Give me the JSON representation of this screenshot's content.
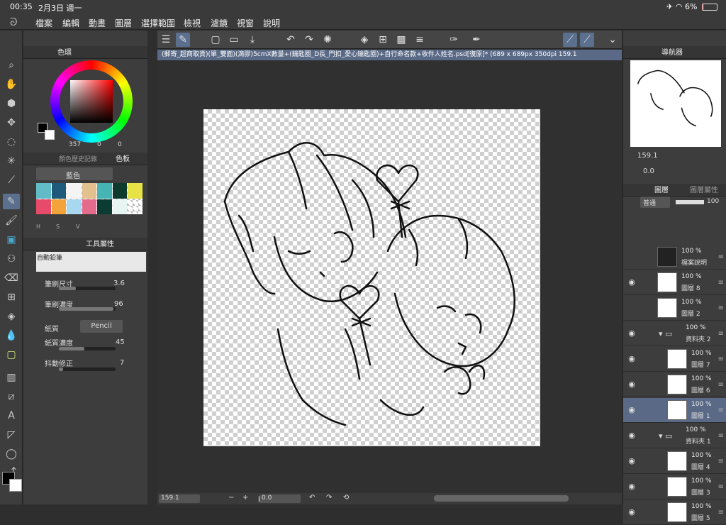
{
  "status_bar": {
    "time": "00:35",
    "date": "2月3日 週一",
    "battery": "6%"
  },
  "menu": [
    "檔案",
    "編輯",
    "動畫",
    "圖層",
    "選擇範圍",
    "檢視",
    "濾鏡",
    "視窗",
    "說明"
  ],
  "document": {
    "tab_title": "(郵寄_超商取貨)(單_雙面)(滴膠)5cmX數量+(鑰匙圈_D長_門扣_愛心鑰匙圈)+自行命名款+收件人姓名.psd[復原]* (689 x 689px 350dpi 159.1"
  },
  "color_panel": {
    "title": "色環",
    "hsv": {
      "h": "357",
      "s": "0",
      "v": "0"
    },
    "set_tab1": "顏色歷史記錄",
    "set_tab2": "色板",
    "set_name": "藍色",
    "swatch_colors": [
      "#62bcc8",
      "#1f5a7a",
      "#f4f4f4",
      "#e2c18f",
      "#45b4b2",
      "#0e3a2e",
      "#e7e347",
      "#e84a6a",
      "#f2a43a",
      "#a8d8ef",
      "#e56b8d",
      "#0b3b33",
      "#e7f6f2"
    ],
    "palette_labels": [
      "H",
      "S",
      "V"
    ]
  },
  "tool_property": {
    "title": "工具屬性",
    "brush_name": "自動鉛筆",
    "props": [
      {
        "label": "筆刷尺寸",
        "value": "3.6",
        "fill": 0.3
      },
      {
        "label": "筆刷濃度",
        "value": "96",
        "fill": 0.96
      },
      {
        "label": "紙質",
        "value": "Pencil"
      },
      {
        "label": "紙質濃度",
        "value": "45",
        "fill": 0.45
      },
      {
        "label": "抖動修正",
        "value": "7",
        "fill": 0.07
      }
    ]
  },
  "navigator": {
    "title": "導航器",
    "zoom": "159.1",
    "angle": "0.0"
  },
  "layers_panel": {
    "tab1": "圖層",
    "tab2": "圖層屬性",
    "blend_mode": "普通",
    "opacity": "100",
    "layers": [
      {
        "pct": "100 %",
        "name": "檔案說明",
        "visible": false,
        "thumb": "dark"
      },
      {
        "pct": "100 %",
        "name": "圖層 8",
        "visible": true,
        "thumb": "light"
      },
      {
        "pct": "100 %",
        "name": "圖層 2",
        "visible": false,
        "thumb": "text"
      },
      {
        "pct": "100 %",
        "name": "資料夾 2",
        "visible": true,
        "folder": true
      },
      {
        "pct": "100 %",
        "name": "圖層 7",
        "visible": true,
        "thumb": "sketch",
        "indent": true
      },
      {
        "pct": "100 %",
        "name": "圖層 6",
        "visible": true,
        "thumb": "sketch",
        "indent": true
      },
      {
        "pct": "100 %",
        "name": "圖層 1",
        "visible": true,
        "thumb": "light",
        "indent": true,
        "selected": true
      },
      {
        "pct": "100 %",
        "name": "資料夾 1",
        "visible": true,
        "folder": true
      },
      {
        "pct": "100 %",
        "name": "圖層 4",
        "visible": true,
        "thumb": "sketch",
        "indent": true
      },
      {
        "pct": "100 %",
        "name": "圖層 3",
        "visible": true,
        "thumb": "sketch",
        "indent": true
      },
      {
        "pct": "100 %",
        "name": "圖層 5",
        "visible": true,
        "thumb": "sketch",
        "indent": true
      }
    ]
  },
  "bottom_bar": {
    "zoom": "159.1",
    "angle": "0.0"
  }
}
